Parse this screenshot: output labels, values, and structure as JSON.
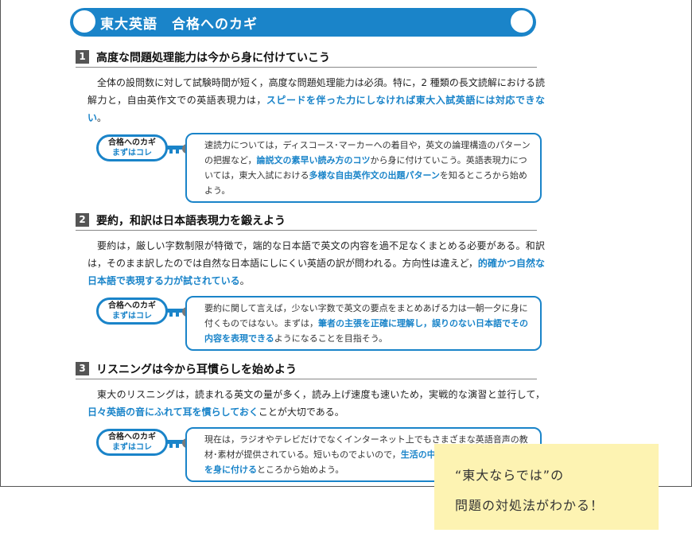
{
  "banner": {
    "title": "東大英語　合格へのカギ"
  },
  "sections": [
    {
      "number": "1",
      "heading": "高度な問題処理能力は今から身に付けていこう",
      "para": [
        {
          "text": "全体の設問数に対して試験時間が短く，高度な問題処理能力は必須。特に，2 種類の長文読解における読解力と，自由英作文での英語表現力は，"
        },
        {
          "text": "スピードを伴った力にしなければ東大入試英語には対応できない",
          "hl": true
        },
        {
          "text": "。"
        }
      ],
      "kagi_label_1": "合格へのカギ",
      "kagi_label_2": "まずはコレ",
      "kagi": [
        {
          "text": "速読力については，ディスコース･マーカーへの着目や，英文の論理構造のパターンの把握など，"
        },
        {
          "text": "論説文の素早い読み方のコツ",
          "hl": true
        },
        {
          "text": "から身に付けていこう。英語表現力については，東大入試における"
        },
        {
          "text": "多様な自由英作文の出題パターン",
          "hl": true
        },
        {
          "text": "を知るところから始めよう。"
        }
      ]
    },
    {
      "number": "2",
      "heading": "要約，和訳は日本語表現力を鍛えよう",
      "para": [
        {
          "text": "要約は，厳しい字数制限が特徴で，端的な日本語で英文の内容を過不足なくまとめる必要がある。和訳は，そのまま訳したのでは自然な日本語にしにくい英語の訳が問われる。方向性は違えど，"
        },
        {
          "text": "的確かつ自然な日本語で表現する力が試されている",
          "hl": true
        },
        {
          "text": "。"
        }
      ],
      "kagi_label_1": "合格へのカギ",
      "kagi_label_2": "まずはコレ",
      "kagi": [
        {
          "text": "要約に関して言えば，少ない字数で英文の要点をまとめあげる力は一朝一夕に身に付くものではない。まずは，"
        },
        {
          "text": "筆者の主張を正確に理解し，誤りのない日本語でその内容を表現できる",
          "hl": true
        },
        {
          "text": "ようになることを目指そう。"
        }
      ]
    },
    {
      "number": "3",
      "heading": "リスニングは今から耳慣らしを始めよう",
      "para": [
        {
          "text": "東大のリスニングは，読まれる英文の量が多く，読み上げ速度も速いため，実戦的な演習と並行して，"
        },
        {
          "text": "日々英語の音にふれて耳を慣らしておく",
          "hl": true
        },
        {
          "text": "ことが大切である。"
        }
      ],
      "kagi_label_1": "合格へのカギ",
      "kagi_label_2": "まずはコレ",
      "kagi": [
        {
          "text": "現在は，ラジオやテレビだけでなくインターネット上でもさまざまな英語音声の教材･素材が提供されている。短いものでよいので，"
        },
        {
          "text": "生活の中で英語の音にふれる習慣を身に付ける",
          "hl": true
        },
        {
          "text": "ところから始めよう。"
        }
      ]
    }
  ],
  "note": {
    "line1": "“東大ならでは”の",
    "line2": "問題の対処法がわかる！"
  },
  "colors": {
    "accent": "#1a84c9",
    "note_bg": "#fdf3b2"
  }
}
